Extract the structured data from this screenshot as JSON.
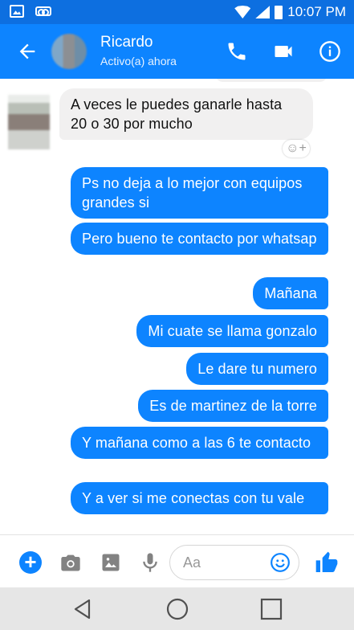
{
  "status_bar": {
    "time": "10:07 PM",
    "icons": [
      "image-notification-icon",
      "voicemail-icon",
      "wifi-icon",
      "cell-signal-icon",
      "battery-icon"
    ]
  },
  "header": {
    "back_icon": "back-arrow-icon",
    "contact_name": "Ricardo",
    "contact_status": "Activo(a) ahora",
    "actions": [
      "phone-icon",
      "video-camera-icon",
      "info-icon"
    ],
    "background": "#0d84ff"
  },
  "messages": [
    {
      "direction": "incoming",
      "text": "A veces le puedes ganarle hasta 20 o 30 por mucho"
    },
    {
      "direction": "outgoing",
      "text": "Ps no deja a lo mejor con equipos grandes si"
    },
    {
      "direction": "outgoing",
      "text": "Pero bueno te contacto por whatsap"
    },
    {
      "direction": "outgoing",
      "text": "Mañana"
    },
    {
      "direction": "outgoing",
      "text": "Mi cuate se llama gonzalo"
    },
    {
      "direction": "outgoing",
      "text": "Le dare tu numero"
    },
    {
      "direction": "outgoing",
      "text": "Es de martinez de la torre"
    },
    {
      "direction": "outgoing",
      "text": "Y mañana como a las 6 te contacto"
    },
    {
      "direction": "outgoing",
      "text": "Y a ver si me conectas con tu vale"
    }
  ],
  "composer": {
    "placeholder": "Aa",
    "icons": [
      "add-icon",
      "camera-icon",
      "gallery-icon",
      "microphone-icon",
      "emoji-icon",
      "thumbs-up-icon"
    ]
  },
  "nav_bar": {
    "icons": [
      "nav-back-icon",
      "nav-home-icon",
      "nav-recents-icon"
    ]
  },
  "colors": {
    "accent": "#0d84ff",
    "status_bar": "#0d6fe0",
    "incoming_bubble": "#f1f0f0",
    "outgoing_bubble": "#0d84ff"
  }
}
